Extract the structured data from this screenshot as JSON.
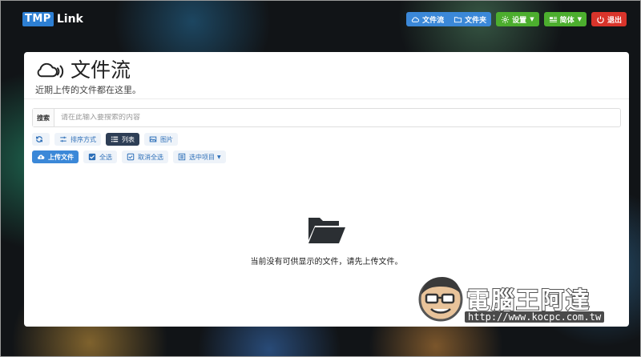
{
  "logo": {
    "box": "TMP",
    "text": "Link"
  },
  "topbar": {
    "stream_label": "文件流",
    "folder_label": "文件夹",
    "settings_label": "设置",
    "lang_label": "简体",
    "logout_label": "退出"
  },
  "header": {
    "title": "文件流",
    "subtitle": "近期上传的文件都在这里。"
  },
  "search": {
    "label": "搜索",
    "placeholder": "请在此输入要搜索的内容",
    "value": ""
  },
  "toolbar": {
    "sort_label": "排序方式",
    "list_label": "列表",
    "image_label": "图片",
    "upload_label": "上传文件",
    "select_all_label": "全选",
    "deselect_all_label": "取消全选",
    "selected_items_label": "选中项目"
  },
  "empty": {
    "message": "当前没有可供显示的文件，请先上传文件。"
  },
  "watermark": {
    "title": "電腦王阿達",
    "url": "http://www.kocpc.com.tw"
  },
  "colors": {
    "primary": "#3b88d8",
    "green": "#4cae2e",
    "red": "#d9342b",
    "active_dark": "#2e3e55"
  }
}
